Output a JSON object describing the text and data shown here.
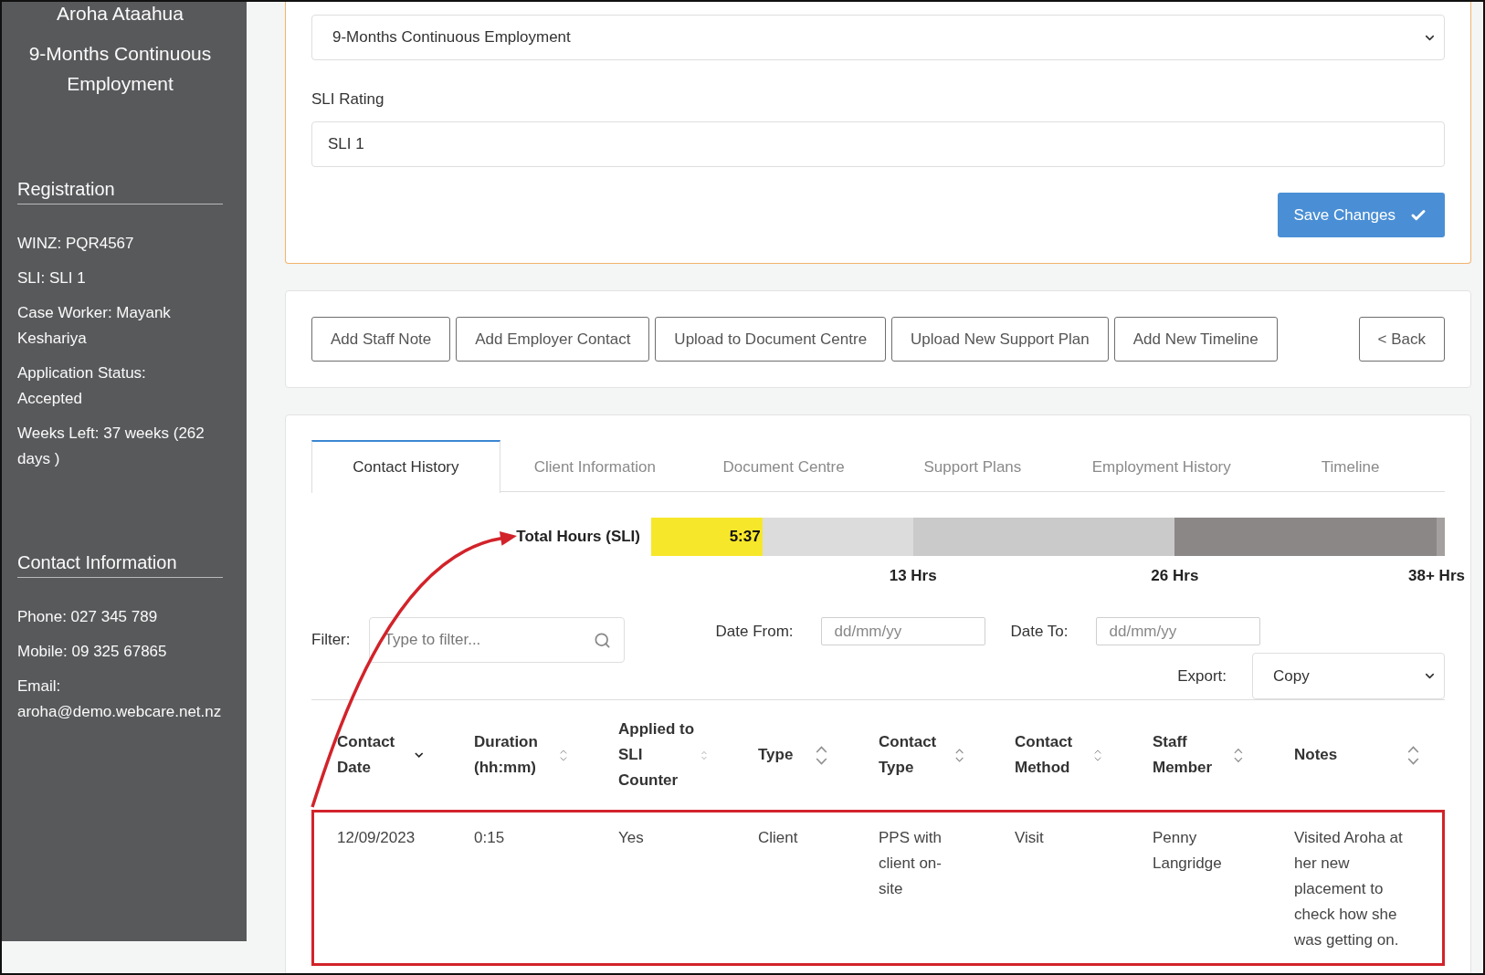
{
  "sidebar": {
    "client_name": "Aroha Ataahua",
    "program": "9-Months Continuous Employment",
    "sections": [
      {
        "heading": "Registration",
        "items": [
          "WINZ: PQR4567",
          "SLI: SLI 1",
          "Case Worker: Mayank Keshariya",
          "Application Status: Accepted",
          "Weeks Left: 37 weeks (262 days )"
        ]
      },
      {
        "heading": "Contact Information",
        "items": [
          "Phone: 027 345 789",
          "Mobile: 09 325 67865",
          "Email: aroha@demo.webcare.net.nz"
        ]
      }
    ]
  },
  "program_form": {
    "program_select": {
      "value": "9-Months Continuous Employment"
    },
    "sli_rating": {
      "label": "SLI Rating",
      "value": "SLI 1"
    },
    "save_button": "Save Changes"
  },
  "actions": {
    "buttons": [
      "Add Staff Note",
      "Add Employer Contact",
      "Upload to Document Centre",
      "Upload New Support Plan",
      "Add New Timeline"
    ],
    "back_button": "< Back"
  },
  "tabs": [
    {
      "label": "Contact History",
      "selected": true
    },
    {
      "label": "Client Information",
      "selected": false
    },
    {
      "label": "Document Centre",
      "selected": false
    },
    {
      "label": "Support Plans",
      "selected": false
    },
    {
      "label": "Employment History",
      "selected": false
    },
    {
      "label": "Timeline",
      "selected": false
    }
  ],
  "hours_meter": {
    "label": "Total Hours (SLI)",
    "reading": "5:37",
    "level": 0.14,
    "bands": [
      {
        "label": "13 Hrs",
        "color": "#dcdcdc"
      },
      {
        "label": "26 Hrs",
        "color": "#cacaca"
      },
      {
        "label": "38+ Hrs",
        "color": "#8b8786"
      }
    ]
  },
  "filters": {
    "filter": {
      "label": "Filter:",
      "placeholder": "Type to filter..."
    },
    "date_from": {
      "label": "Date From:",
      "placeholder": "dd/mm/yy"
    },
    "date_to": {
      "label": "Date To:",
      "placeholder": "dd/mm/yy"
    },
    "export": {
      "label": "Export:",
      "value": "Copy"
    }
  },
  "table": {
    "columns": [
      {
        "label": "Contact Date",
        "sorted": true
      },
      {
        "label": "Duration (hh:mm)",
        "sorted": false
      },
      {
        "label": "Applied to SLI Counter",
        "sorted": false
      },
      {
        "label": "Type",
        "sorted": false
      },
      {
        "label": "Contact Type",
        "sorted": false
      },
      {
        "label": "Contact Method",
        "sorted": false
      },
      {
        "label": "Staff Member",
        "sorted": false
      },
      {
        "label": "Notes",
        "sorted": false
      }
    ],
    "rows": [
      {
        "highlighted": true,
        "cells": [
          "12/09/2023",
          "0:15",
          "Yes",
          "Client",
          "PPS with client on-site",
          "Visit",
          "Penny Langridge",
          "Visited Aroha at her new placement to check how she was getting on."
        ]
      }
    ]
  }
}
